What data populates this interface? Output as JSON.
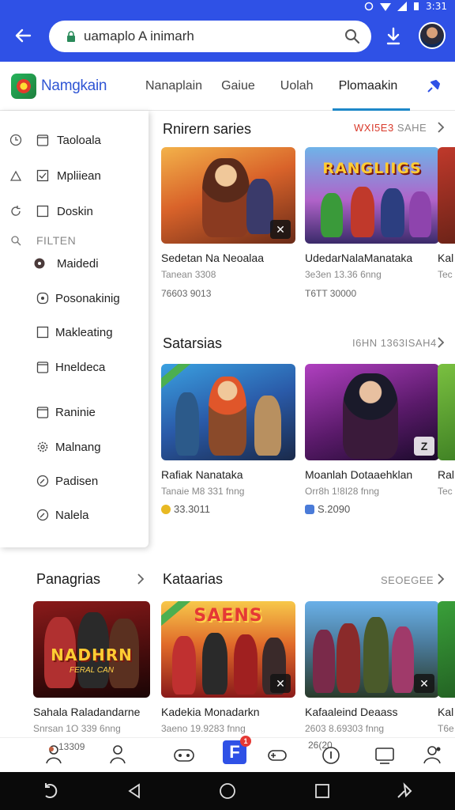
{
  "status_bar": {
    "time": "3:31"
  },
  "url_bar": {
    "value": "uamaplo A inimarh"
  },
  "app": {
    "brand": "Namgkain",
    "tabs": [
      "Nanaplain",
      "Gaiue",
      "Uolah",
      "Plomaakin"
    ],
    "active_tab_index": 3
  },
  "drawer": {
    "items": [
      {
        "label": "Taoloala",
        "icon": "clock-icon"
      },
      {
        "label": "Mpliiean",
        "icon": "person-icon"
      },
      {
        "label": "Doskin",
        "icon": "refresh-icon"
      }
    ],
    "subheader": "FILTEN",
    "filters": [
      {
        "label": "Maidedi",
        "icon": "donut-icon"
      },
      {
        "label": "Posonakinig",
        "icon": "toggle-icon"
      },
      {
        "label": "Makleating",
        "icon": "square-icon"
      },
      {
        "label": "Hneldeca",
        "icon": "tablet-icon"
      },
      {
        "label": "Raninie",
        "icon": "tablet-icon"
      },
      {
        "label": "Malnang",
        "icon": "gear-icon"
      },
      {
        "label": "Padisen",
        "icon": "compass-icon"
      },
      {
        "label": "Nalela",
        "icon": "compass-icon"
      }
    ]
  },
  "sections": {
    "s1": {
      "title": "Rnirern saries",
      "meta_red": "WXI5E3",
      "meta": "SAHE",
      "cards": [
        {
          "name": "Sedetan Na Neoalaa",
          "sub": "Tanean 3308",
          "price": "76603 9013"
        },
        {
          "name": "UdedarNalaManataka",
          "sub": "3e3en 13.36 6nng",
          "price": "T6TT 30000",
          "art_text": "RANGLIIGS"
        },
        {
          "name": "Kal",
          "sub": "Tec",
          "price": ""
        }
      ]
    },
    "s2": {
      "title": "Satarsias",
      "meta": "I6HN 1363ISAH4",
      "cards": [
        {
          "name": "Rafiak Nanataka",
          "sub": "Tanaie M8 331 fnng",
          "price": "33.3011"
        },
        {
          "name": "Moanlah Dotaaehklan",
          "sub": "Orr8h 1!8I28 fnng",
          "price": "S.2090"
        },
        {
          "name": "Ral",
          "sub": "Tec",
          "price": ""
        }
      ]
    },
    "s3": {
      "title": "Panagrias",
      "card": {
        "name": "Sahala Raladandarne",
        "sub": "Snrsan 1O 339 6nng",
        "art_text": "NADHRN",
        "art_sub": "FERAL CAN"
      }
    },
    "s4": {
      "title": "Kataarias",
      "meta": "SEOEGEE",
      "cards": [
        {
          "name": "Kadekia Monadarkn",
          "sub": "3aeno 19.9283 fnng",
          "art_text": "SAENS"
        },
        {
          "name": "Kafaaleind Deaass",
          "sub": "2603 8.69303 fnng"
        },
        {
          "name": "Kal",
          "sub": "T6e"
        }
      ]
    }
  },
  "bottom_nav": {
    "left_text": "13309",
    "mid_text": "26(20",
    "notif_count": "1"
  }
}
